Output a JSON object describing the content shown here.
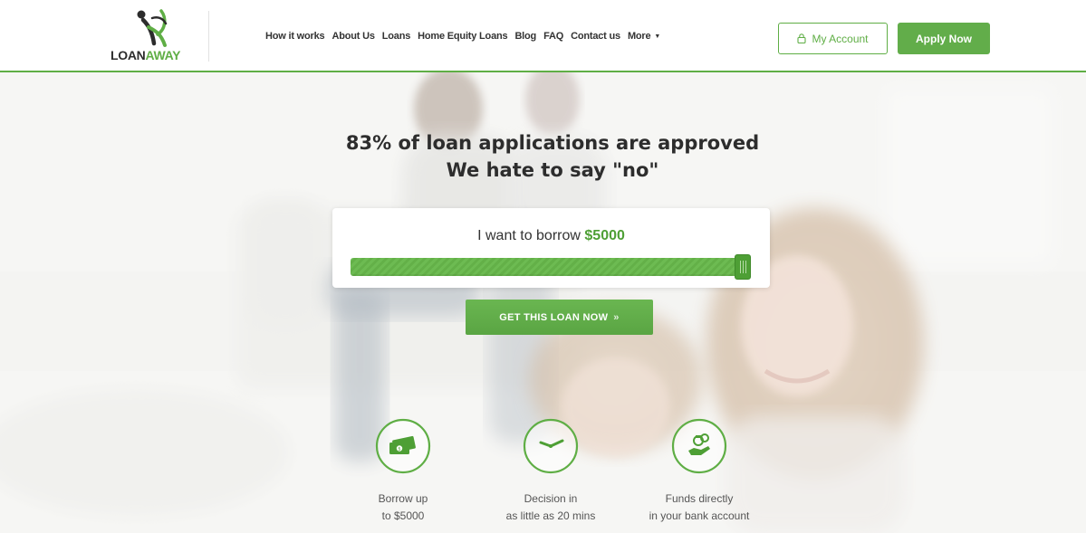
{
  "logo": {
    "text_part1": "LOAN",
    "text_part2": "AWAY",
    "icon": "runner-logo-icon"
  },
  "nav": {
    "items": [
      {
        "label": "How it works"
      },
      {
        "label": "About Us"
      },
      {
        "label": "Loans"
      },
      {
        "label": "Home Equity Loans"
      },
      {
        "label": "Blog"
      },
      {
        "label": "FAQ"
      },
      {
        "label": "Contact us"
      },
      {
        "label": "More"
      }
    ],
    "more_icon": "caret-down-icon"
  },
  "header": {
    "account_label": "My Account",
    "account_icon": "lock-icon",
    "apply_label": "Apply Now"
  },
  "hero": {
    "headline_line1": "83% of loan applications are approved",
    "headline_line2": "We hate to say \"no\"",
    "borrow_prefix": "I want to borrow",
    "borrow_amount": "$5000",
    "slider_value_fraction": 1.0,
    "cta_label": "GET THIS LOAN NOW",
    "cta_icon": "double-chevron-right-icon"
  },
  "features": [
    {
      "icon": "cash-icon",
      "line1": "Borrow up",
      "line2": "to $5000"
    },
    {
      "icon": "clock-icon",
      "line1": "Decision in",
      "line2": "as little as 20 mins"
    },
    {
      "icon": "hand-coins-icon",
      "line1": "Funds directly",
      "line2": "in your bank account"
    }
  ],
  "colors": {
    "brand_green": "#5fae45",
    "button_green": "#62ad4a",
    "amount_green": "#4e9f35",
    "text_dark": "#2d2d2d"
  }
}
